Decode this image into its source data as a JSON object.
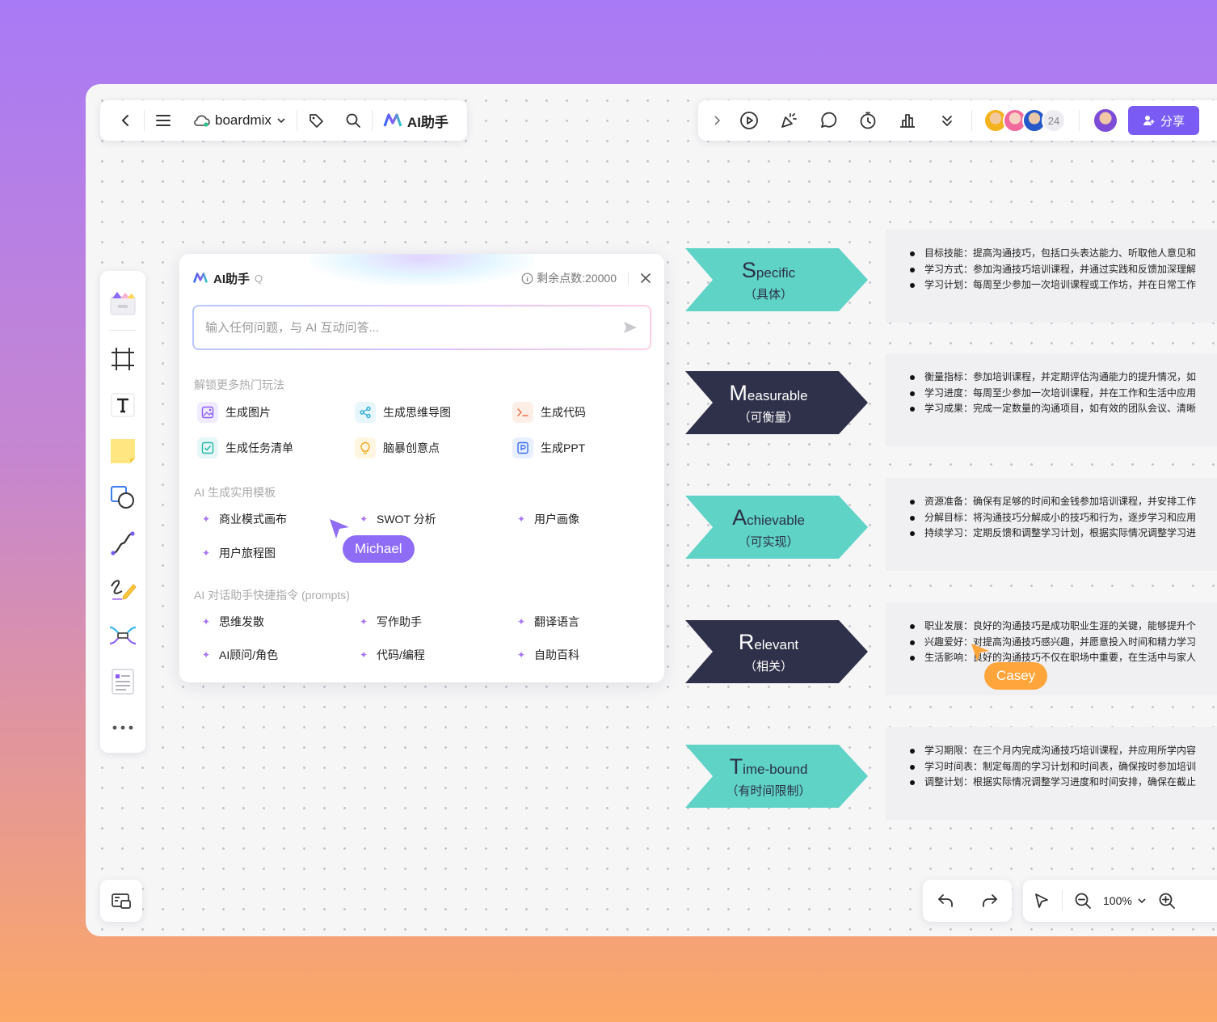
{
  "toolbar_left": {
    "brand": "boardmix",
    "ai_label": "AI助手"
  },
  "toolbar_right": {
    "avatar_count": "24",
    "share_label": "分享"
  },
  "ai_dialog": {
    "title": "AI助手",
    "shortcut": "Q",
    "points": "剩余点数:20000",
    "input_placeholder": "输入任何问题，与 AI 互动问答...",
    "section1_title": "解锁更多热门玩法",
    "section1_items": [
      "生成图片",
      "生成思维导图",
      "生成代码",
      "生成任务清单",
      "脑暴创意点",
      "生成PPT"
    ],
    "section2_title": "AI 生成实用模板",
    "section2_items": [
      "商业模式画布",
      "SWOT 分析",
      "用户画像",
      "用户旅程图"
    ],
    "section3_title": "AI 对话助手快捷指令 (prompts)",
    "section3_items": [
      "思维发散",
      "写作助手",
      "翻译语言",
      "AI顾问/角色",
      "代码/编程",
      "自助百科"
    ]
  },
  "cursors": {
    "michael": "Michael",
    "casey": "Casey",
    "michael_color": "#8f6cf5",
    "casey_color": "#ffa53b"
  },
  "smart": [
    {
      "initial": "S",
      "rest": "pecific",
      "sub": "（具体）",
      "color": "#5ed3c6",
      "bullets": [
        "目标技能：提高沟通技巧，包括口头表达能力、听取他人意见和",
        "学习方式：参加沟通技巧培训课程，并通过实践和反馈加深理解",
        "学习计划：每周至少参加一次培训课程或工作坊，并在日常工作"
      ]
    },
    {
      "initial": "M",
      "rest": "easurable",
      "sub": "（可衡量）",
      "color": "#2f3049",
      "bullets": [
        "衡量指标：参加培训课程，并定期评估沟通能力的提升情况，如",
        "学习进度：每周至少参加一次培训课程，并在工作和生活中应用",
        "学习成果：完成一定数量的沟通项目，如有效的团队会议、清晰"
      ]
    },
    {
      "initial": "A",
      "rest": "chievable",
      "sub": "（可实现）",
      "color": "#5ed3c6",
      "bullets": [
        "资源准备：确保有足够的时间和金钱参加培训课程，并安排工作",
        "分解目标：将沟通技巧分解成小的技巧和行为，逐步学习和应用",
        "持续学习：定期反馈和调整学习计划，根据实际情况调整学习进"
      ]
    },
    {
      "initial": "R",
      "rest": "elevant",
      "sub": "（相关）",
      "color": "#2f3049",
      "bullets": [
        "职业发展：良好的沟通技巧是成功职业生涯的关键，能够提升个",
        "兴趣爱好：对提高沟通技巧感兴趣，并愿意投入时间和精力学习",
        "生活影响：良好的沟通技巧不仅在职场中重要，在生活中与家人"
      ]
    },
    {
      "initial": "T",
      "rest": "ime-bound",
      "sub": "（有时间限制）",
      "color": "#5ed3c6",
      "bullets": [
        "学习期限：在三个月内完成沟通技巧培训课程，并应用所学内容",
        "学习时间表：制定每周的学习计划和时间表，确保按时参加培训",
        "调整计划：根据实际情况调整学习进度和时间安排，确保在截止"
      ]
    }
  ],
  "zoom": {
    "level": "100%"
  }
}
